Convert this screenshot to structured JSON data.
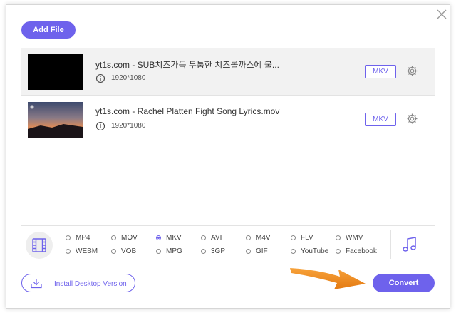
{
  "toolbar": {
    "add_file_label": "Add File"
  },
  "files": [
    {
      "name": "yt1s.com - SUB치즈가득 두툼한 치즈롤까스에 불...",
      "resolution": "1920*1080",
      "format": "MKV"
    },
    {
      "name": "yt1s.com - Rachel Platten Fight Song Lyrics.mov",
      "resolution": "1920*1080",
      "format": "MKV"
    }
  ],
  "formats": {
    "selected": "MKV",
    "row1": [
      "MP4",
      "MOV",
      "MKV",
      "AVI",
      "M4V",
      "FLV",
      "WMV"
    ],
    "row2": [
      "WEBM",
      "VOB",
      "MPG",
      "3GP",
      "GIF",
      "YouTube",
      "Facebook"
    ]
  },
  "footer": {
    "install_label": "Install Desktop Version",
    "convert_label": "Convert"
  },
  "colors": {
    "accent": "#6e62ec",
    "arrow": "#f08a1e"
  }
}
